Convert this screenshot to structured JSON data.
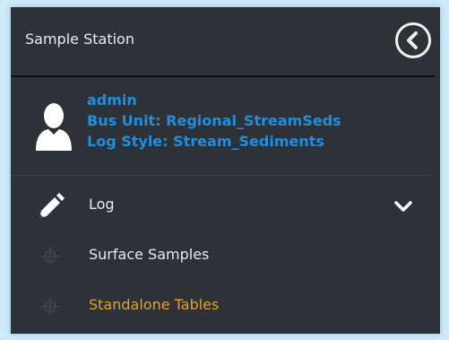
{
  "panel": {
    "title": "Sample Station",
    "back_icon": "chevron-left-circle-icon"
  },
  "user": {
    "name": "admin",
    "bus_unit": "Bus Unit: Regional_StreamSeds",
    "log_style": "Log Style: Stream_Sediments",
    "avatar_icon": "person-icon",
    "text_color": "#1e8fe0"
  },
  "menu": {
    "log": {
      "label": "Log",
      "icon": "pencil-icon",
      "expand_icon": "chevron-down-icon"
    },
    "items": [
      {
        "label": "Surface Samples",
        "icon": "crosshair-icon"
      },
      {
        "label": "Standalone Tables",
        "icon": "crosshair-icon",
        "color": "#e8a020"
      }
    ]
  },
  "colors": {
    "panel_bg": "#2c3237",
    "accent": "#e8a020",
    "frame": "#cfeaf8"
  }
}
